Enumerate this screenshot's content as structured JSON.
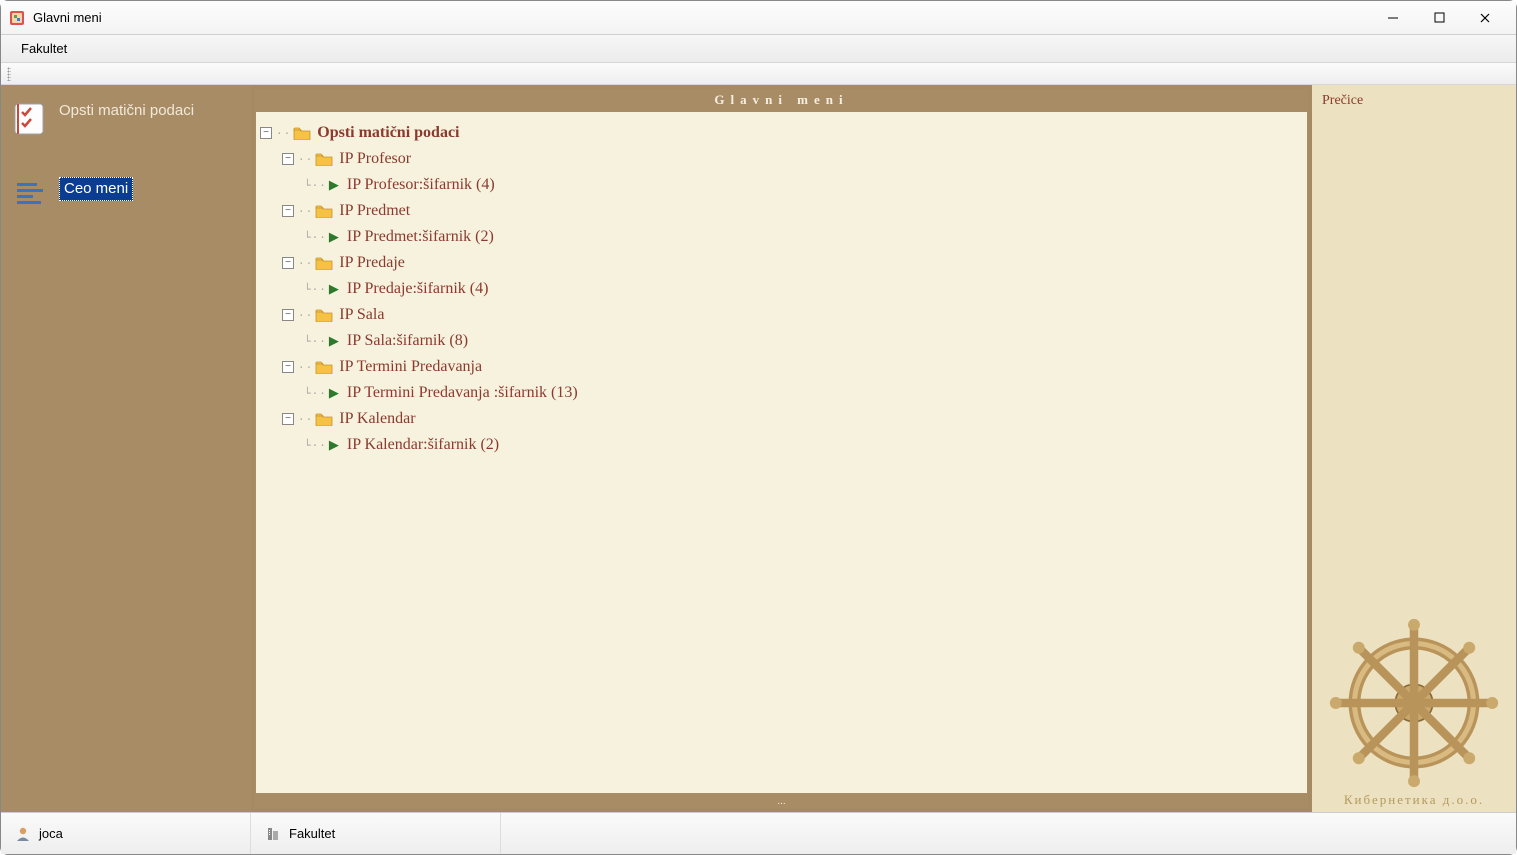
{
  "window": {
    "title": "Glavni meni"
  },
  "menubar": {
    "items": [
      "Fakultet"
    ]
  },
  "sidebar": {
    "items": [
      {
        "label": "Opsti matični podaci",
        "icon": "checklist",
        "selected": false
      },
      {
        "label": "Ceo meni",
        "icon": "list",
        "selected": true
      }
    ]
  },
  "center": {
    "header": "Glavni meni",
    "footer": "...",
    "tree": {
      "label": "Opsti matični podaci",
      "children": [
        {
          "label": "IP Profesor",
          "children": [
            {
              "label": "IP Profesor:šifarnik (4)",
              "leaf": true
            }
          ]
        },
        {
          "label": "IP Predmet",
          "children": [
            {
              "label": "IP Predmet:šifarnik (2)",
              "leaf": true
            }
          ]
        },
        {
          "label": "IP Predaje",
          "children": [
            {
              "label": "IP Predaje:šifarnik (4)",
              "leaf": true
            }
          ]
        },
        {
          "label": "IP Sala",
          "children": [
            {
              "label": "IP Sala:šifarnik (8)",
              "leaf": true
            }
          ]
        },
        {
          "label": "IP Termini Predavanja",
          "children": [
            {
              "label": "IP Termini Predavanja :šifarnik (13)",
              "leaf": true
            }
          ]
        },
        {
          "label": "IP Kalendar",
          "children": [
            {
              "label": "IP Kalendar:šifarnik (2)",
              "leaf": true
            }
          ]
        }
      ]
    }
  },
  "rightpanel": {
    "title": "Prečice",
    "brand": "Кибернетика д.о.о."
  },
  "statusbar": {
    "user": "joca",
    "context": "Fakultet"
  }
}
